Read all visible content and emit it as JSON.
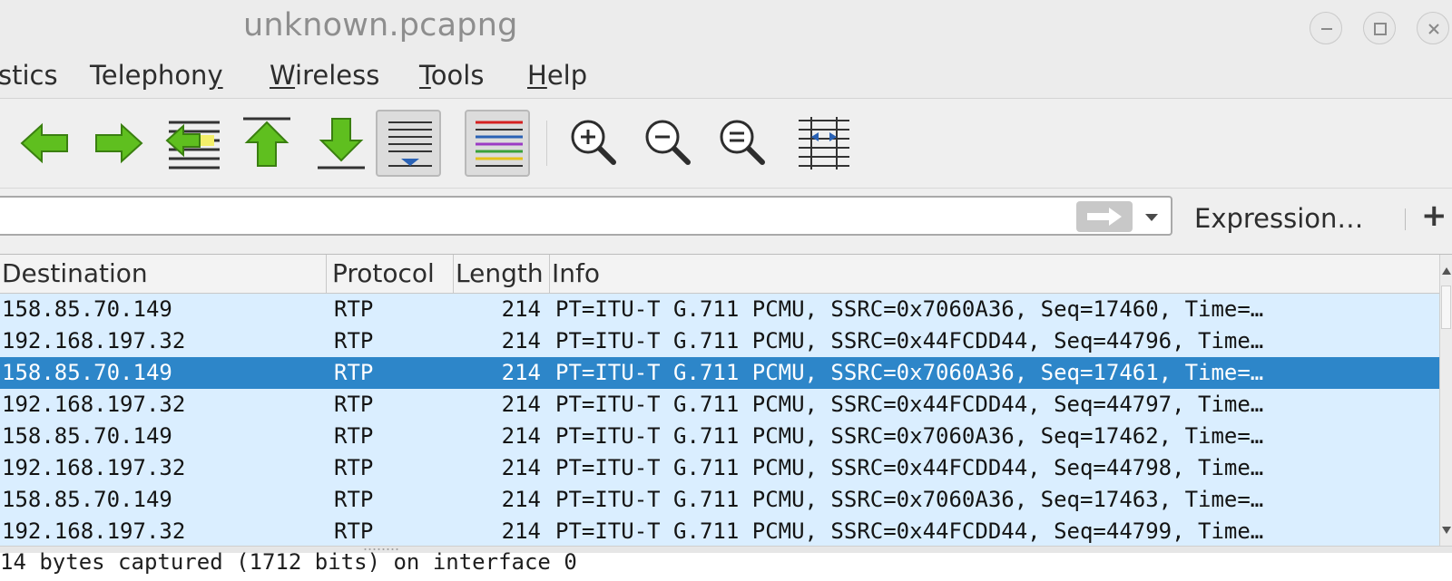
{
  "window": {
    "title": "unknown.pcapng"
  },
  "menubar": {
    "items": [
      {
        "text": "stics",
        "underline": ""
      },
      {
        "text": "Telephony",
        "underline": "y"
      },
      {
        "text": "Wireless",
        "underline": "W"
      },
      {
        "text": "Tools",
        "underline": "T"
      },
      {
        "text": "Help",
        "underline": "H"
      }
    ]
  },
  "toolbar": {
    "icons": [
      "go-back-icon",
      "go-forward-icon",
      "go-to-packet-icon",
      "go-first-packet-icon",
      "go-last-packet-icon",
      "auto-scroll-icon",
      "colorize-icon",
      "zoom-in-icon",
      "zoom-out-icon",
      "zoom-normal-icon",
      "resize-columns-icon"
    ]
  },
  "filter": {
    "value": "",
    "expression_label": "Expression…",
    "add_label": "+"
  },
  "packet_list": {
    "columns": [
      "Destination",
      "Protocol",
      "Length",
      "Info"
    ],
    "rows": [
      {
        "destination": "158.85.70.149",
        "protocol": "RTP",
        "length": "214",
        "info": "PT=ITU-T G.711 PCMU, SSRC=0x7060A36, Seq=17460, Time=…",
        "selected": false
      },
      {
        "destination": "192.168.197.32",
        "protocol": "RTP",
        "length": "214",
        "info": "PT=ITU-T G.711 PCMU, SSRC=0x44FCDD44, Seq=44796, Time…",
        "selected": false
      },
      {
        "destination": "158.85.70.149",
        "protocol": "RTP",
        "length": "214",
        "info": "PT=ITU-T G.711 PCMU, SSRC=0x7060A36, Seq=17461, Time=…",
        "selected": true
      },
      {
        "destination": "192.168.197.32",
        "protocol": "RTP",
        "length": "214",
        "info": "PT=ITU-T G.711 PCMU, SSRC=0x44FCDD44, Seq=44797, Time…",
        "selected": false
      },
      {
        "destination": "158.85.70.149",
        "protocol": "RTP",
        "length": "214",
        "info": "PT=ITU-T G.711 PCMU, SSRC=0x7060A36, Seq=17462, Time=…",
        "selected": false
      },
      {
        "destination": "192.168.197.32",
        "protocol": "RTP",
        "length": "214",
        "info": "PT=ITU-T G.711 PCMU, SSRC=0x44FCDD44, Seq=44798, Time…",
        "selected": false
      },
      {
        "destination": "158.85.70.149",
        "protocol": "RTP",
        "length": "214",
        "info": "PT=ITU-T G.711 PCMU, SSRC=0x7060A36, Seq=17463, Time=…",
        "selected": false
      },
      {
        "destination": "192.168.197.32",
        "protocol": "RTP",
        "length": "214",
        "info": "PT=ITU-T G.711 PCMU, SSRC=0x44FCDD44, Seq=44799, Time…",
        "selected": false
      }
    ]
  },
  "details": {
    "line": "14 bytes captured (1712 bits) on interface 0"
  },
  "colors": {
    "row_bg": "#daeeff",
    "selected_bg": "#2d86c9",
    "arrow_green": "#5fbf1f"
  }
}
